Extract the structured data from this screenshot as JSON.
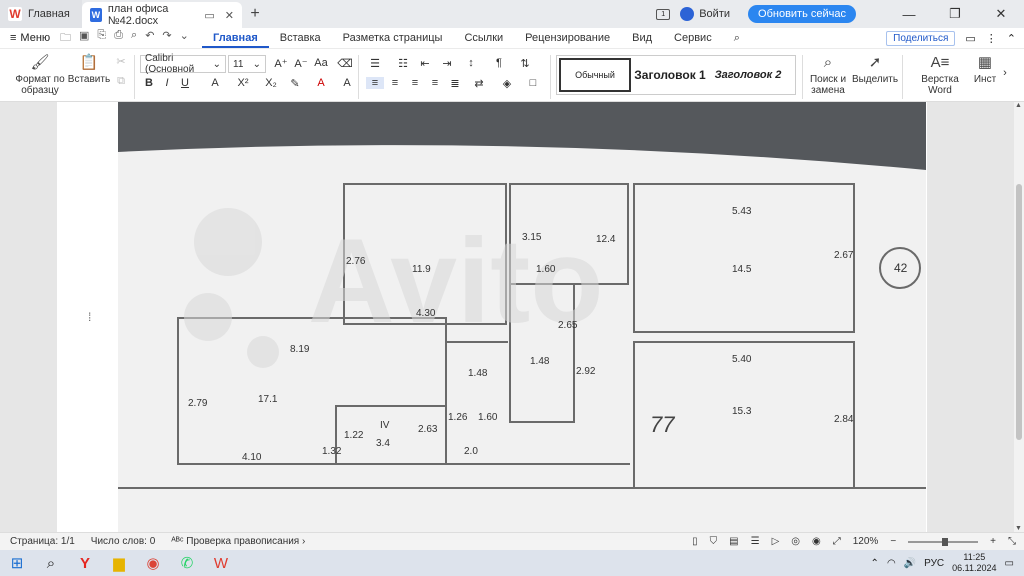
{
  "tabs": {
    "home": "Главная",
    "document": "план офиса №42.docx"
  },
  "titlebar": {
    "login": "Войти",
    "update": "Обновить сейчас"
  },
  "menubar": {
    "menu": "Меню",
    "tabs": [
      "Главная",
      "Вставка",
      "Разметка страницы",
      "Ссылки",
      "Рецензирование",
      "Вид",
      "Сервис"
    ],
    "share": "Поделиться"
  },
  "ribbon": {
    "format_painter": "Формат по образцу",
    "paste": "Вставить",
    "font_name": "Calibri (Основной",
    "font_size": "11",
    "styles": [
      "Обычный",
      "Заголовок 1",
      "Заголовок 2"
    ],
    "find_replace": "Поиск и замена",
    "select": "Выделить",
    "word_version": "Верстка Word",
    "tools": "Инст"
  },
  "plan": {
    "labels": [
      "5.43",
      "2.67",
      "14.5",
      "12.4",
      "3.15",
      "1.60",
      "11.9",
      "2.76",
      "4.30",
      "2.65",
      "2.92",
      "1.48",
      "8.19",
      "5.40",
      "2.79",
      "17.1",
      "1.48",
      "1.60",
      "15.3",
      "2.84",
      "1.32",
      "1.22",
      "3.4",
      "2.63",
      "1.26",
      "2.0",
      "4.10",
      "42",
      "IV",
      "77"
    ]
  },
  "statusbar": {
    "page": "Страница: 1/1",
    "words": "Число слов: 0",
    "spell": "Проверка правописания",
    "zoom": "120%",
    "lang": "РУС",
    "time": "11:25",
    "date": "06.11.2024"
  }
}
